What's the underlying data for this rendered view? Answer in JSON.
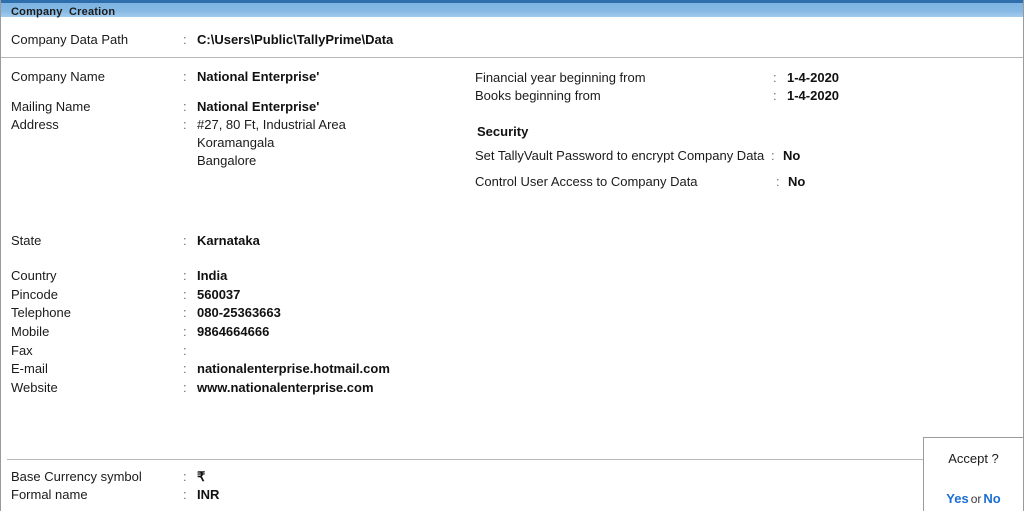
{
  "window": {
    "title": "Company  Creation"
  },
  "header": {
    "data_path": {
      "label": "Company Data Path",
      "separator": ":",
      "value": "C:\\Users\\Public\\TallyPrime\\Data"
    }
  },
  "left_column": {
    "company_name": {
      "label": "Company Name",
      "separator": ":",
      "value": "National Enterprise'"
    },
    "mailing_name": {
      "label": "Mailing Name",
      "separator": ":",
      "value": "National Enterprise'"
    },
    "address": {
      "label": "Address",
      "separator": ":",
      "lines": [
        "#27, 80 Ft, Industrial Area",
        "Koramangala",
        "Bangalore"
      ]
    },
    "state": {
      "label": "State",
      "separator": ":",
      "value": "Karnataka"
    },
    "country": {
      "label": "Country",
      "separator": ":",
      "value": "India"
    },
    "pincode": {
      "label": "Pincode",
      "separator": ":",
      "value": "560037"
    },
    "telephone": {
      "label": "Telephone",
      "separator": ":",
      "value": "080-25363663"
    },
    "mobile": {
      "label": "Mobile",
      "separator": ":",
      "value": "9864664666"
    },
    "fax": {
      "label": "Fax",
      "separator": ":",
      "value": ""
    },
    "email": {
      "label": "E-mail",
      "separator": ":",
      "value": "nationalenterprise.hotmail.com"
    },
    "website": {
      "label": "Website",
      "separator": ":",
      "value": "www.nationalenterprise.com"
    }
  },
  "right_column": {
    "financial_year": {
      "label": "Financial year beginning from",
      "separator": ":",
      "value": "1-4-2020"
    },
    "books_beginning": {
      "label": "Books beginning from",
      "separator": ":",
      "value": "1-4-2020"
    },
    "security_heading": "Security",
    "tallyvault": {
      "label": "Set TallyVault Password to encrypt Company Data",
      "separator": ":",
      "value": "No"
    },
    "user_access": {
      "label": "Control User Access to Company Data",
      "separator": ":",
      "value": "No"
    }
  },
  "footer": {
    "currency_symbol": {
      "label": "Base Currency symbol",
      "separator": ":",
      "value": "₹"
    },
    "formal_name": {
      "label": "Formal name",
      "separator": ":",
      "value": "INR"
    }
  },
  "accept_dialog": {
    "title": "Accept ?",
    "yes": "Yes",
    "or": "or",
    "no": "No"
  },
  "colors": {
    "titlebar_top": "#2f6ead",
    "titlebar_fill": "#7fb4e2",
    "accent_link": "#1b6fd2",
    "divider": "#b8b8b8",
    "text": "#1b1b1b"
  }
}
